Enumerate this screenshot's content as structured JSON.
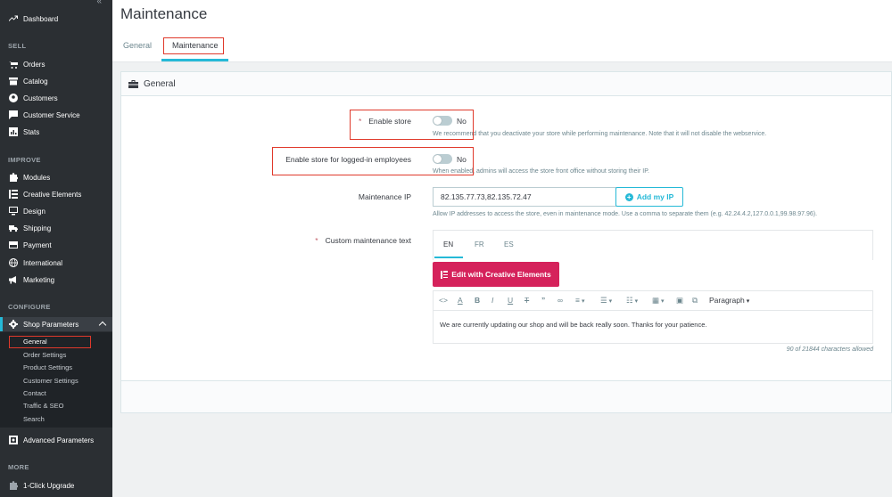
{
  "sidebar": {
    "dashboard": "Dashboard",
    "sections": {
      "sell": "SELL",
      "improve": "IMPROVE",
      "configure": "CONFIGURE",
      "more": "MORE"
    },
    "sell_items": [
      "Orders",
      "Catalog",
      "Customers",
      "Customer Service",
      "Stats"
    ],
    "improve_items": [
      "Modules",
      "Creative Elements",
      "Design",
      "Shipping",
      "Payment",
      "International",
      "Marketing"
    ],
    "configure_active": "Shop Parameters",
    "shop_params_sub": [
      "General",
      "Order Settings",
      "Product Settings",
      "Customer Settings",
      "Contact",
      "Traffic & SEO",
      "Search"
    ],
    "advanced": "Advanced Parameters",
    "one_click": "1-Click Upgrade"
  },
  "header": {
    "title": "Maintenance",
    "tabs": [
      "General",
      "Maintenance"
    ]
  },
  "card": {
    "title": "General",
    "enable_store": {
      "label": "Enable store",
      "value": "No",
      "help": "We recommend that you deactivate your store while performing maintenance. Note that it will not disable the webservice."
    },
    "enable_employees": {
      "label": "Enable store for logged-in employees",
      "value": "No",
      "help": "When enabled, admins will access the store front office without storing their IP."
    },
    "maintenance_ip": {
      "label": "Maintenance IP",
      "value": "82.135.77.73,82.135.72.47",
      "button": "Add my IP",
      "help": "Allow IP addresses to access the store, even in maintenance mode. Use a comma to separate them (e.g. 42.24.4.2,127.0.0.1,99.98.97.96)."
    },
    "custom_text": {
      "label": "Custom maintenance text",
      "languages": [
        "EN",
        "FR",
        "ES"
      ],
      "ce_button": "Edit with Creative Elements",
      "paragraph": "Paragraph",
      "content": "We are currently updating our shop and will be back really soon. Thanks for your patience.",
      "char_count": "90 of 21844 characters allowed"
    }
  },
  "colors": {
    "accent": "#25b9d7",
    "ce_brand": "#d5225b",
    "sidebar_bg": "#2b2f33",
    "highlight": "#e0392b"
  }
}
